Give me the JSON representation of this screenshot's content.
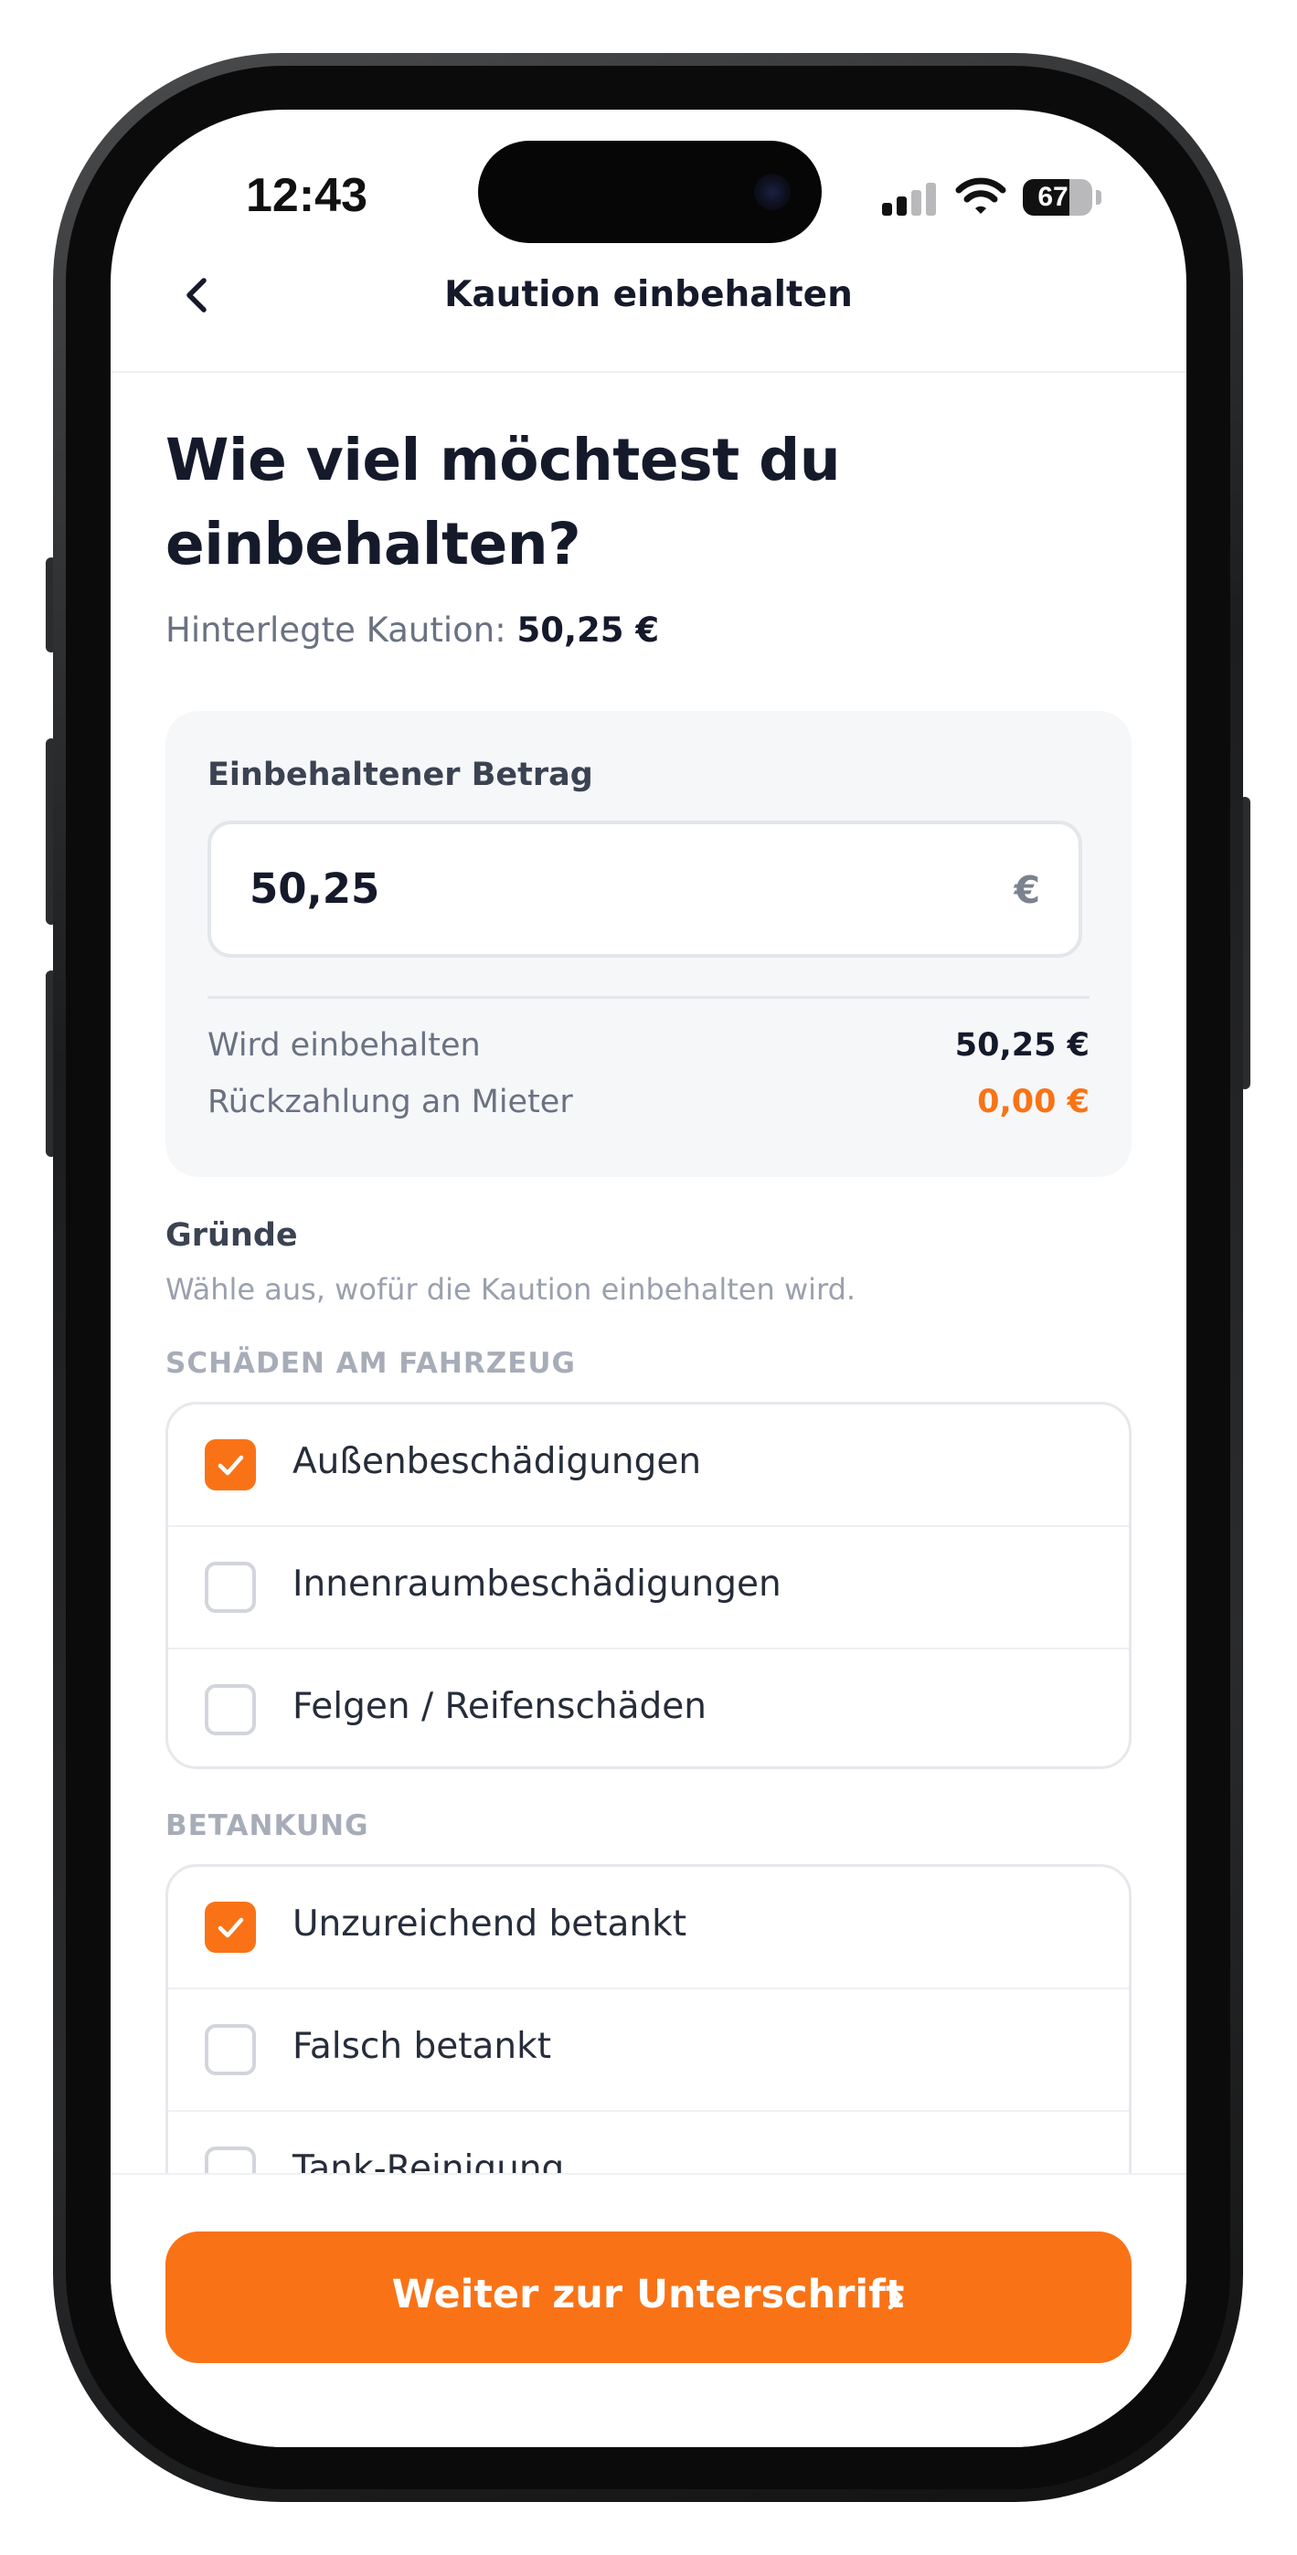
{
  "status_bar": {
    "time": "12:43",
    "battery": "67"
  },
  "nav": {
    "title": "Kaution einbehalten"
  },
  "header": {
    "headline_line1": "Wie viel möchtest du",
    "headline_line2": "einbehalten?",
    "deposit_label": "Hinterlegte Kaution:",
    "deposit_amount": "50,25 €"
  },
  "amount_card": {
    "label": "Einbehaltener Betrag",
    "input_value": "50,25",
    "currency_symbol": "€",
    "retained_label": "Wird einbehalten",
    "retained_value": "50,25 €",
    "refund_label": "Rückzahlung an Mieter",
    "refund_value": "0,00 €"
  },
  "reasons": {
    "title": "Gründe",
    "subtitle": "Wähle aus, wofür die Kaution einbehalten wird.",
    "sections": [
      {
        "label": "SCHÄDEN AM FAHRZEUG",
        "options": [
          {
            "label": "Außenbeschädigungen",
            "checked": true
          },
          {
            "label": "Innenraumbeschädigungen",
            "checked": false
          },
          {
            "label": "Felgen / Reifenschäden",
            "checked": false
          }
        ]
      },
      {
        "label": "BETANKUNG",
        "options": [
          {
            "label": "Unzureichend betankt",
            "checked": true
          },
          {
            "label": "Falsch betankt",
            "checked": false
          },
          {
            "label": "Tank-Reinigung",
            "checked": false
          }
        ]
      }
    ]
  },
  "footer": {
    "cta_label": "Weiter zur Unterschrift"
  },
  "colors": {
    "accent": "#f97316",
    "text_primary": "#151a2b",
    "text_secondary": "#6a7282",
    "card_background": "#f6f7f9"
  },
  "icons": {
    "back": "chevron-left-icon",
    "checkbox_checked": "check-icon",
    "cta_arrow": "chevron-right-icon",
    "signal": "cellular-signal-icon",
    "wifi": "wifi-icon",
    "battery": "battery-icon"
  }
}
